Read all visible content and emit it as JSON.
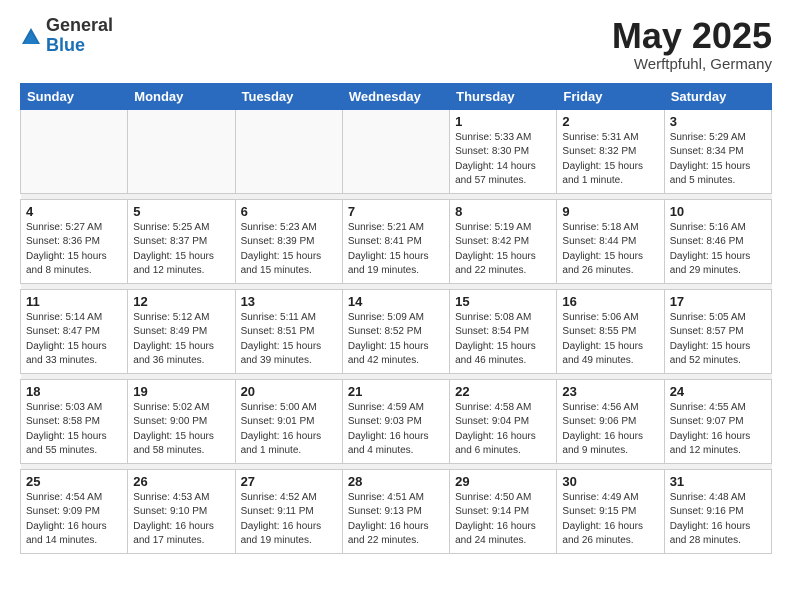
{
  "logo": {
    "general": "General",
    "blue": "Blue"
  },
  "header": {
    "month": "May 2025",
    "location": "Werftpfuhl, Germany"
  },
  "weekdays": [
    "Sunday",
    "Monday",
    "Tuesday",
    "Wednesday",
    "Thursday",
    "Friday",
    "Saturday"
  ],
  "weeks": [
    [
      {
        "day": "",
        "info": ""
      },
      {
        "day": "",
        "info": ""
      },
      {
        "day": "",
        "info": ""
      },
      {
        "day": "",
        "info": ""
      },
      {
        "day": "1",
        "info": "Sunrise: 5:33 AM\nSunset: 8:30 PM\nDaylight: 14 hours\nand 57 minutes."
      },
      {
        "day": "2",
        "info": "Sunrise: 5:31 AM\nSunset: 8:32 PM\nDaylight: 15 hours\nand 1 minute."
      },
      {
        "day": "3",
        "info": "Sunrise: 5:29 AM\nSunset: 8:34 PM\nDaylight: 15 hours\nand 5 minutes."
      }
    ],
    [
      {
        "day": "4",
        "info": "Sunrise: 5:27 AM\nSunset: 8:36 PM\nDaylight: 15 hours\nand 8 minutes."
      },
      {
        "day": "5",
        "info": "Sunrise: 5:25 AM\nSunset: 8:37 PM\nDaylight: 15 hours\nand 12 minutes."
      },
      {
        "day": "6",
        "info": "Sunrise: 5:23 AM\nSunset: 8:39 PM\nDaylight: 15 hours\nand 15 minutes."
      },
      {
        "day": "7",
        "info": "Sunrise: 5:21 AM\nSunset: 8:41 PM\nDaylight: 15 hours\nand 19 minutes."
      },
      {
        "day": "8",
        "info": "Sunrise: 5:19 AM\nSunset: 8:42 PM\nDaylight: 15 hours\nand 22 minutes."
      },
      {
        "day": "9",
        "info": "Sunrise: 5:18 AM\nSunset: 8:44 PM\nDaylight: 15 hours\nand 26 minutes."
      },
      {
        "day": "10",
        "info": "Sunrise: 5:16 AM\nSunset: 8:46 PM\nDaylight: 15 hours\nand 29 minutes."
      }
    ],
    [
      {
        "day": "11",
        "info": "Sunrise: 5:14 AM\nSunset: 8:47 PM\nDaylight: 15 hours\nand 33 minutes."
      },
      {
        "day": "12",
        "info": "Sunrise: 5:12 AM\nSunset: 8:49 PM\nDaylight: 15 hours\nand 36 minutes."
      },
      {
        "day": "13",
        "info": "Sunrise: 5:11 AM\nSunset: 8:51 PM\nDaylight: 15 hours\nand 39 minutes."
      },
      {
        "day": "14",
        "info": "Sunrise: 5:09 AM\nSunset: 8:52 PM\nDaylight: 15 hours\nand 42 minutes."
      },
      {
        "day": "15",
        "info": "Sunrise: 5:08 AM\nSunset: 8:54 PM\nDaylight: 15 hours\nand 46 minutes."
      },
      {
        "day": "16",
        "info": "Sunrise: 5:06 AM\nSunset: 8:55 PM\nDaylight: 15 hours\nand 49 minutes."
      },
      {
        "day": "17",
        "info": "Sunrise: 5:05 AM\nSunset: 8:57 PM\nDaylight: 15 hours\nand 52 minutes."
      }
    ],
    [
      {
        "day": "18",
        "info": "Sunrise: 5:03 AM\nSunset: 8:58 PM\nDaylight: 15 hours\nand 55 minutes."
      },
      {
        "day": "19",
        "info": "Sunrise: 5:02 AM\nSunset: 9:00 PM\nDaylight: 15 hours\nand 58 minutes."
      },
      {
        "day": "20",
        "info": "Sunrise: 5:00 AM\nSunset: 9:01 PM\nDaylight: 16 hours\nand 1 minute."
      },
      {
        "day": "21",
        "info": "Sunrise: 4:59 AM\nSunset: 9:03 PM\nDaylight: 16 hours\nand 4 minutes."
      },
      {
        "day": "22",
        "info": "Sunrise: 4:58 AM\nSunset: 9:04 PM\nDaylight: 16 hours\nand 6 minutes."
      },
      {
        "day": "23",
        "info": "Sunrise: 4:56 AM\nSunset: 9:06 PM\nDaylight: 16 hours\nand 9 minutes."
      },
      {
        "day": "24",
        "info": "Sunrise: 4:55 AM\nSunset: 9:07 PM\nDaylight: 16 hours\nand 12 minutes."
      }
    ],
    [
      {
        "day": "25",
        "info": "Sunrise: 4:54 AM\nSunset: 9:09 PM\nDaylight: 16 hours\nand 14 minutes."
      },
      {
        "day": "26",
        "info": "Sunrise: 4:53 AM\nSunset: 9:10 PM\nDaylight: 16 hours\nand 17 minutes."
      },
      {
        "day": "27",
        "info": "Sunrise: 4:52 AM\nSunset: 9:11 PM\nDaylight: 16 hours\nand 19 minutes."
      },
      {
        "day": "28",
        "info": "Sunrise: 4:51 AM\nSunset: 9:13 PM\nDaylight: 16 hours\nand 22 minutes."
      },
      {
        "day": "29",
        "info": "Sunrise: 4:50 AM\nSunset: 9:14 PM\nDaylight: 16 hours\nand 24 minutes."
      },
      {
        "day": "30",
        "info": "Sunrise: 4:49 AM\nSunset: 9:15 PM\nDaylight: 16 hours\nand 26 minutes."
      },
      {
        "day": "31",
        "info": "Sunrise: 4:48 AM\nSunset: 9:16 PM\nDaylight: 16 hours\nand 28 minutes."
      }
    ]
  ]
}
